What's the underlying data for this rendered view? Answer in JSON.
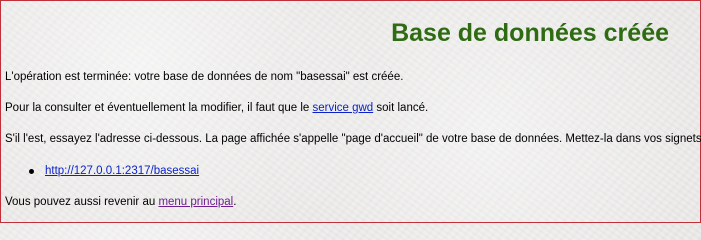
{
  "header": {
    "title": "Base de données créée"
  },
  "content": {
    "p1": "L'opération est terminée: votre base de données de nom \"basessai\" est créée.",
    "p2_before": "Pour la consulter et éventuellement la modifier, il faut que le ",
    "p2_link": "service gwd",
    "p2_after": " soit lancé.",
    "p3": "S'il l'est, essayez l'adresse ci-dessous. La page affichée s'appelle \"page d'accueil\" de votre base de données. Mettez-la dans vos signets.",
    "address_link": "http://127.0.0.1:2317/basessai",
    "p4_before": "Vous pouvez aussi revenir au ",
    "p4_link": "menu principal",
    "p4_after": "."
  },
  "colors": {
    "title": "#2e6b12",
    "link": "#0b22c9",
    "visited_link": "#6e1f8f",
    "border": "#c0303a"
  }
}
